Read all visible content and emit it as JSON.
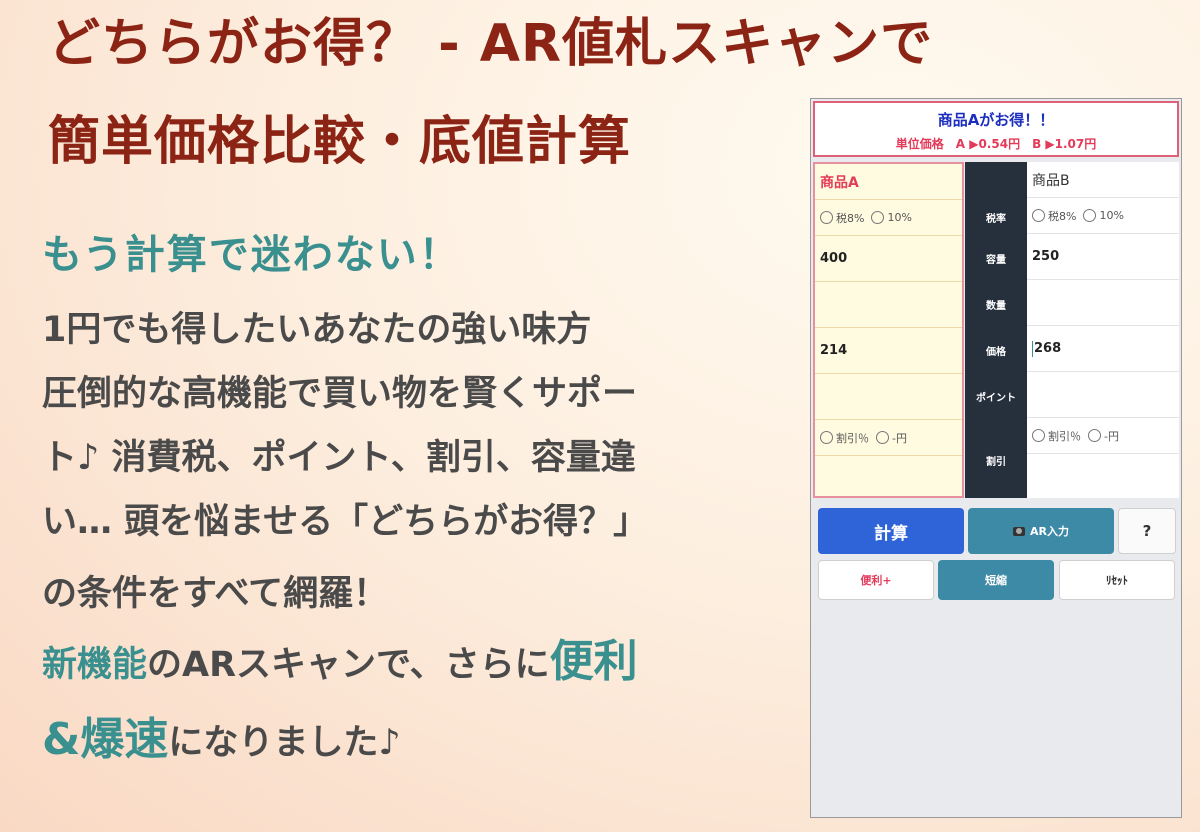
{
  "promo": {
    "title_line1": "どちらがお得？ - AR値札スキャンで",
    "title_line2": "簡単価格比較・底値計算",
    "subtitle": "もう計算で迷わない！",
    "lines": [
      "1円でも得したいあなたの強い味方",
      "圧倒的な高機能で買い物を賢くサポー",
      "ト♪ 消費税、ポイント、割引、容量違",
      "い… 頭を悩ませる「どちらがお得？」",
      "の条件をすべて網羅！"
    ],
    "feature": {
      "new_feature": "新機能",
      "mid": "のARスキャンで、さらに",
      "convenient": "便利",
      "amp": "&",
      "fast": "爆速",
      "tail": "になりました♪"
    }
  },
  "app": {
    "result_title": "商品Aがお得！！",
    "result_unit": "単位価格　A ▶0.54円　B ▶1.07円",
    "product_a": {
      "name": "商品A",
      "tax_opt1": "税8%",
      "tax_opt2": "10%",
      "capacity": "400",
      "quantity": "",
      "price": "214",
      "point": "",
      "discount_opt1": "割引％",
      "discount_opt2": "-円",
      "discount": ""
    },
    "product_b": {
      "name": "商品B",
      "tax_opt1": "税8%",
      "tax_opt2": "10%",
      "capacity": "250",
      "quantity": "",
      "price": "268",
      "point": "",
      "discount_opt1": "割引％",
      "discount_opt2": "-円",
      "discount": ""
    },
    "row_labels": {
      "tax": "税率",
      "capacity": "容量",
      "quantity": "数量",
      "price": "価格",
      "point": "ポイント",
      "discount": "割引"
    },
    "buttons": {
      "calc": "計算",
      "ar": "AR入力",
      "help": "?",
      "favorite": "便利+",
      "shorten": "短縮",
      "reset": "ﾘｾｯﾄ"
    },
    "colors": {
      "accent_blue": "#2f63d8",
      "accent_teal": "#3d8aa6",
      "highlight_red": "#e33b5a",
      "title_red": "#8b2414"
    }
  }
}
